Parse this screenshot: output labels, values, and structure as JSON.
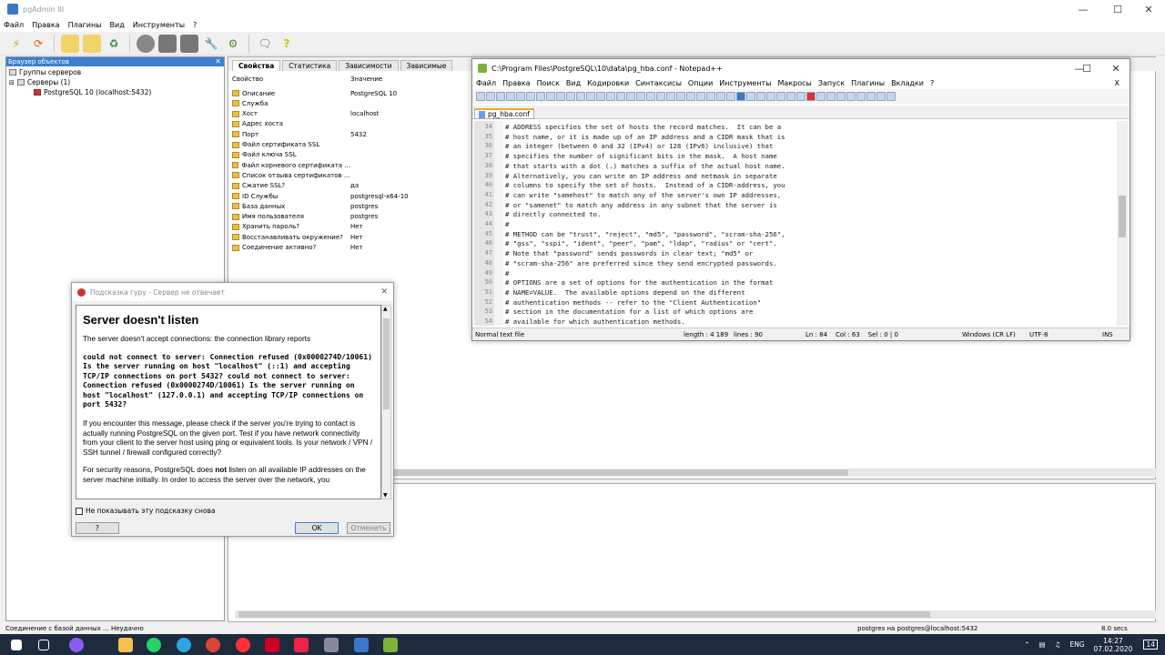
{
  "pgadmin": {
    "title": "pgAdmin III",
    "menu": [
      "Файл",
      "Правка",
      "Плагины",
      "Вид",
      "Инструменты",
      "?"
    ],
    "object_browser": {
      "title": "Браузер объектов",
      "tree": [
        "Группы серверов",
        "Серверы (1)",
        "PostgreSQL 10 (localhost:5432)"
      ]
    },
    "tabs": [
      "Свойства",
      "Статистика",
      "Зависимости",
      "Зависимые"
    ],
    "props_header": {
      "key": "Свойство",
      "value": "Значение"
    },
    "properties": [
      {
        "k": "Описание",
        "v": "PostgreSQL 10"
      },
      {
        "k": "Служба",
        "v": ""
      },
      {
        "k": "Хост",
        "v": "localhost"
      },
      {
        "k": "Адрес хоста",
        "v": ""
      },
      {
        "k": "Порт",
        "v": "5432"
      },
      {
        "k": "Файл сертификата SSL",
        "v": ""
      },
      {
        "k": "Файл ключа SSL",
        "v": ""
      },
      {
        "k": "Файл корневого сертификата ...",
        "v": ""
      },
      {
        "k": "Список отзыва сертификатов ...",
        "v": ""
      },
      {
        "k": "Сжатие SSL?",
        "v": "да"
      },
      {
        "k": "ID Службы",
        "v": "postgresql-x64-10"
      },
      {
        "k": "База данных",
        "v": "postgres"
      },
      {
        "k": "Имя пользователя",
        "v": "postgres"
      },
      {
        "k": "Хранить пароль?",
        "v": "Нет"
      },
      {
        "k": "Восстанавливать окружение?",
        "v": "Нет"
      },
      {
        "k": "Соединение активно?",
        "v": "Нет"
      }
    ],
    "status": {
      "left": "Соединение с базой данных ... Неудачно",
      "right": "postgres на postgres@localhost:5432",
      "time": "8.0 secs"
    }
  },
  "notepad": {
    "title": "C:\\Program Files\\PostgreSQL\\10\\data\\pg_hba.conf - Notepad++",
    "menu": [
      "Файл",
      "Правка",
      "Поиск",
      "Вид",
      "Кодировки",
      "Синтаксисы",
      "Опции",
      "Инструменты",
      "Макросы",
      "Запуск",
      "Плагины",
      "Вкладки",
      "?"
    ],
    "menu_close": "X",
    "tab": "pg_hba.conf",
    "lines": [
      {
        "n": "34",
        "t": "# ADDRESS specifies the set of hosts the record matches.  It can be a"
      },
      {
        "n": "35",
        "t": "# host name, or it is made up of an IP address and a CIDR mask that is"
      },
      {
        "n": "36",
        "t": "# an integer (between 0 and 32 (IPv4) or 128 (IPv6) inclusive) that"
      },
      {
        "n": "37",
        "t": "# specifies the number of significant bits in the mask.  A host name"
      },
      {
        "n": "38",
        "t": "# that starts with a dot (.) matches a suffix of the actual host name."
      },
      {
        "n": "39",
        "t": "# Alternatively, you can write an IP address and netmask in separate"
      },
      {
        "n": "40",
        "t": "# columns to specify the set of hosts.  Instead of a CIDR-address, you"
      },
      {
        "n": "41",
        "t": "# can write \"samehost\" to match any of the server's own IP addresses,"
      },
      {
        "n": "42",
        "t": "# or \"samenet\" to match any address in any subnet that the server is"
      },
      {
        "n": "43",
        "t": "# directly connected to."
      },
      {
        "n": "44",
        "t": "#"
      },
      {
        "n": "45",
        "t": "# METHOD can be \"trust\", \"reject\", \"md5\", \"password\", \"scram-sha-256\","
      },
      {
        "n": "46",
        "t": "# \"gss\", \"sspi\", \"ident\", \"peer\", \"pam\", \"ldap\", \"radius\" or \"cert\"."
      },
      {
        "n": "47",
        "t": "# Note that \"password\" sends passwords in clear text; \"md5\" or"
      },
      {
        "n": "48",
        "t": "# \"scram-sha-256\" are preferred since they send encrypted passwords."
      },
      {
        "n": "49",
        "t": "#"
      },
      {
        "n": "50",
        "t": "# OPTIONS are a set of options for the authentication in the format"
      },
      {
        "n": "51",
        "t": "# NAME=VALUE.  The available options depend on the different"
      },
      {
        "n": "52",
        "t": "# authentication methods -- refer to the \"Client Authentication\""
      },
      {
        "n": "53",
        "t": "# section in the documentation for a list of which options are"
      },
      {
        "n": "54",
        "t": "# available for which authentication methods."
      }
    ],
    "status": {
      "type": "Normal text file",
      "length": "length : 4 189",
      "lines": "lines : 90",
      "pos": "Ln : 84    Col : 63    Sel : 0 | 0",
      "eol": "Windows (CR LF)",
      "enc": "UTF-8",
      "mode": "INS"
    }
  },
  "hint": {
    "title": "Подсказка гуру - Сервер не отвечает",
    "heading": "Server doesn't listen",
    "p1": "The server doesn't accept connections: the connection library reports",
    "error": "could not connect to server: Connection refused (0x0000274D/10061) Is the server running on host \"localhost\" (::1) and accepting TCP/IP connections on port 5432? could not connect to server: Connection refused (0x0000274D/10061) Is the server running on host \"localhost\" (127.0.0.1) and accepting TCP/IP connections on port 5432?",
    "p2": "If you encounter this message, please check if the server you're trying to contact is actually running PostgreSQL on the given port. Test if you have network connectivity from your client to the server host using ping or equivalent tools. Is your network / VPN / SSH tunnel / firewall configured correctly?",
    "p3a": "For security reasons, PostgreSQL does ",
    "p3b": "not",
    "p3c": " listen on all available IP addresses on the server machine initially. In order to access the server over the network, you",
    "checkbox": "Не показывать эту подсказку снова",
    "help": "?",
    "ok": "OK",
    "cancel": "Отменить"
  },
  "taskbar": {
    "lang": "ENG",
    "time": "14:27",
    "date": "07.02.2020",
    "notif": "14"
  }
}
